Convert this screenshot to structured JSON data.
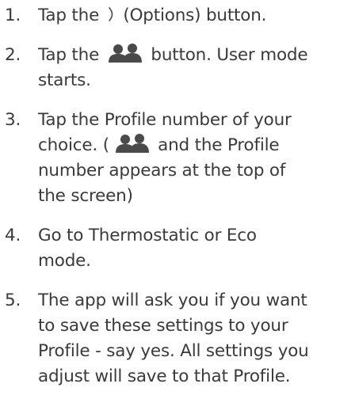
{
  "steps": [
    {
      "number": "1.",
      "parts": {
        "a": "Tap the",
        "b": "(Options) button."
      }
    },
    {
      "number": "2.",
      "parts": {
        "a": "Tap the",
        "b": "button. User mode",
        "c": "starts."
      }
    },
    {
      "number": "3.",
      "parts": {
        "a": "Tap the Profile number of your",
        "b": "choice. (",
        "c": "and the Profile",
        "d": "number appears at the top of",
        "e": "the screen)"
      }
    },
    {
      "number": "4.",
      "parts": {
        "a": "Go to Thermostatic or Eco",
        "b": "mode."
      }
    },
    {
      "number": "5.",
      "parts": {
        "a": "The app will ask you if you want",
        "b": "to save these settings to your",
        "c": "Profile - say yes. All settings you",
        "d": "adjust will save to that Profile."
      }
    }
  ],
  "icons": {
    "options": "chevron-right-icon",
    "users": "users-icon"
  },
  "colors": {
    "text": "#3a3a3a",
    "icon": "#4a4a4a"
  }
}
